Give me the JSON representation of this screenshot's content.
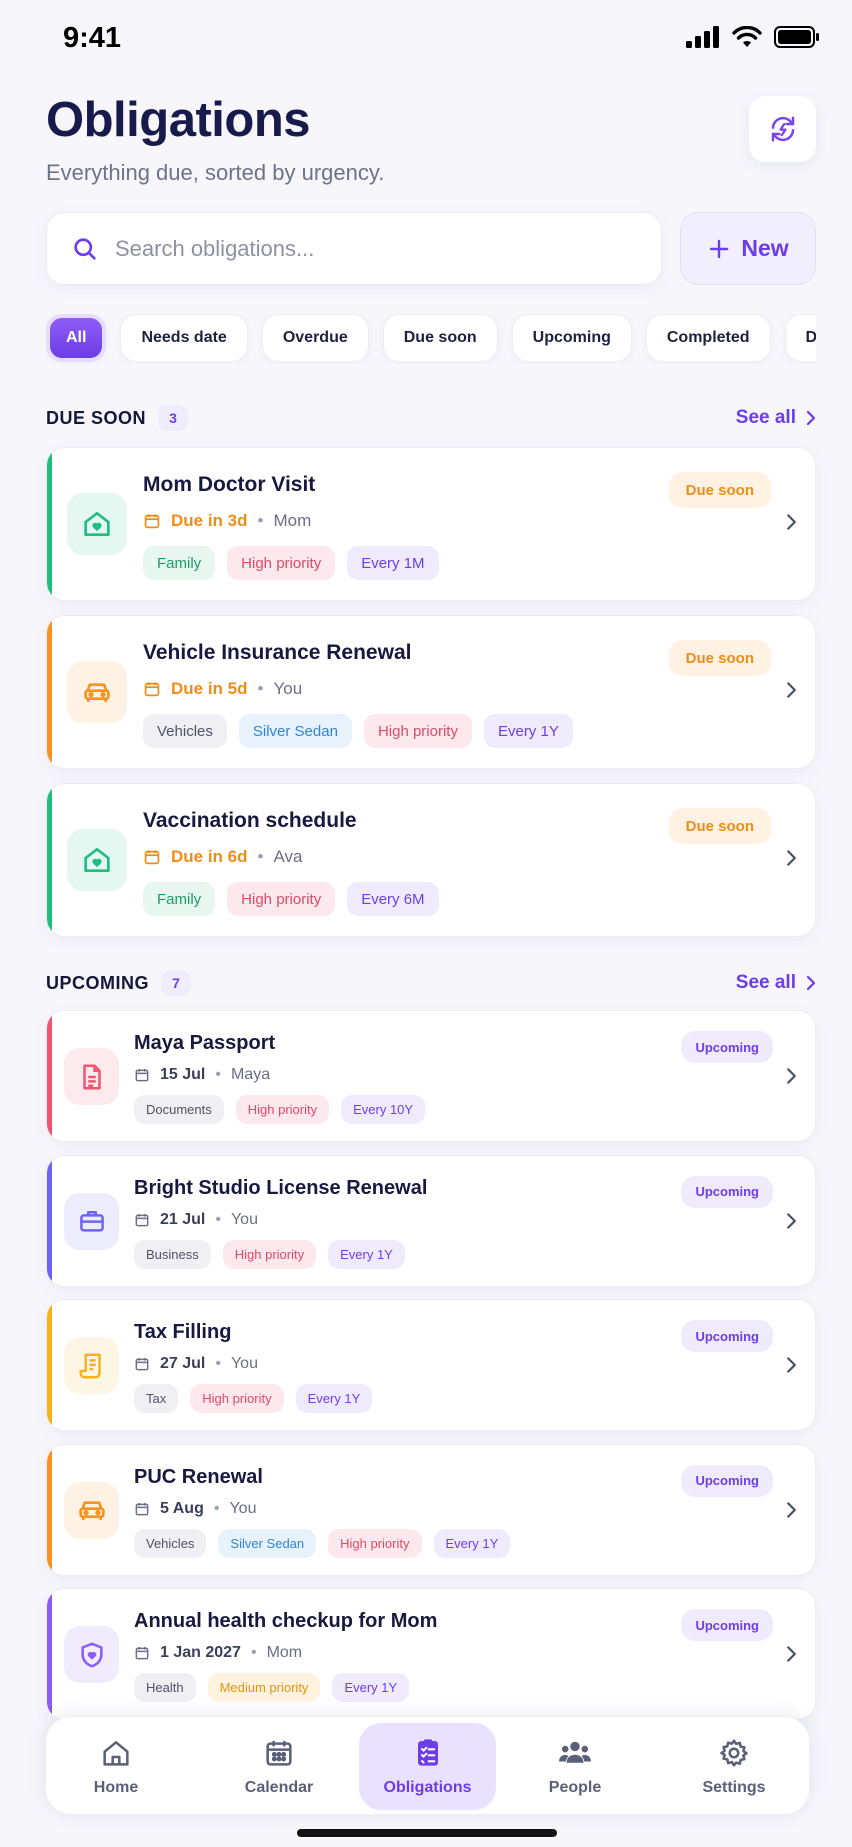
{
  "status_bar": {
    "time": "9:41"
  },
  "header": {
    "title": "Obligations",
    "subtitle": "Everything due, sorted by urgency."
  },
  "search": {
    "placeholder": "Search obligations..."
  },
  "new_button": {
    "label": "New"
  },
  "filters": [
    "All",
    "Needs date",
    "Overdue",
    "Due soon",
    "Upcoming",
    "Completed",
    "Documents"
  ],
  "sections": {
    "due_soon": {
      "title": "DUE SOON",
      "count": "3",
      "see_all": "See all",
      "items": [
        {
          "name": "Mom Doctor Visit",
          "due": "Due in 3d",
          "person": "Mom",
          "status": "Due soon",
          "accent": "#1fbf83",
          "icon": "home-heart-icon",
          "tags": [
            {
              "label": "Family",
              "kind": "t-family"
            },
            {
              "label": "High priority",
              "kind": "t-high"
            },
            {
              "label": "Every 1M",
              "kind": "t-every"
            }
          ]
        },
        {
          "name": "Vehicle Insurance Renewal",
          "due": "Due in 5d",
          "person": "You",
          "status": "Due soon",
          "accent": "#f5941f",
          "icon": "car-icon",
          "tags": [
            {
              "label": "Vehicles",
              "kind": "t-neutral"
            },
            {
              "label": "Silver Sedan",
              "kind": "t-blue"
            },
            {
              "label": "High priority",
              "kind": "t-high"
            },
            {
              "label": "Every 1Y",
              "kind": "t-every"
            }
          ]
        },
        {
          "name": "Vaccination schedule",
          "due": "Due in 6d",
          "person": "Ava",
          "status": "Due soon",
          "accent": "#1fbf83",
          "icon": "home-heart-icon",
          "tags": [
            {
              "label": "Family",
              "kind": "t-family"
            },
            {
              "label": "High priority",
              "kind": "t-high"
            },
            {
              "label": "Every 6M",
              "kind": "t-every"
            }
          ]
        }
      ]
    },
    "upcoming": {
      "title": "UPCOMING",
      "count": "7",
      "see_all": "See all",
      "items": [
        {
          "name": "Maya Passport",
          "due": "15 Jul",
          "person": "Maya",
          "status": "Upcoming",
          "accent": "#f0546f",
          "icon": "document-icon",
          "tags": [
            {
              "label": "Documents",
              "kind": "t-neutral"
            },
            {
              "label": "High priority",
              "kind": "t-high"
            },
            {
              "label": "Every 10Y",
              "kind": "t-every"
            }
          ]
        },
        {
          "name": "Bright Studio License Renewal",
          "due": "21 Jul",
          "person": "You",
          "status": "Upcoming",
          "accent": "#6f63f1",
          "icon": "briefcase-icon",
          "tags": [
            {
              "label": "Business",
              "kind": "t-neutral"
            },
            {
              "label": "High priority",
              "kind": "t-high"
            },
            {
              "label": "Every 1Y",
              "kind": "t-every"
            }
          ]
        },
        {
          "name": "Tax Filling",
          "due": "27 Jul",
          "person": "You",
          "status": "Upcoming",
          "accent": "#f6b21d",
          "icon": "receipt-icon",
          "tags": [
            {
              "label": "Tax",
              "kind": "t-neutral"
            },
            {
              "label": "High priority",
              "kind": "t-high"
            },
            {
              "label": "Every 1Y",
              "kind": "t-every"
            }
          ]
        },
        {
          "name": "PUC Renewal",
          "due": "5 Aug",
          "person": "You",
          "status": "Upcoming",
          "accent": "#f5941f",
          "icon": "car-icon",
          "tags": [
            {
              "label": "Vehicles",
              "kind": "t-neutral"
            },
            {
              "label": "Silver Sedan",
              "kind": "t-blue"
            },
            {
              "label": "High priority",
              "kind": "t-high"
            },
            {
              "label": "Every 1Y",
              "kind": "t-every"
            }
          ]
        },
        {
          "name": "Annual health checkup for Mom",
          "due": "1 Jan 2027",
          "person": "Mom",
          "status": "Upcoming",
          "accent": "#8b5cf6",
          "icon": "shield-heart-icon",
          "tags": [
            {
              "label": "Health",
              "kind": "t-neutral"
            },
            {
              "label": "Medium priority",
              "kind": "t-medium"
            },
            {
              "label": "Every 1Y",
              "kind": "t-every"
            }
          ]
        }
      ]
    }
  },
  "nav": [
    {
      "label": "Home",
      "icon": "home-icon",
      "active": false
    },
    {
      "label": "Calendar",
      "icon": "calendar-icon",
      "active": false
    },
    {
      "label": "Obligations",
      "icon": "clipboard-list-icon",
      "active": true
    },
    {
      "label": "People",
      "icon": "people-icon",
      "active": false
    },
    {
      "label": "Settings",
      "icon": "gear-icon",
      "active": false
    }
  ],
  "colors": {
    "brand": "#6d3ee8",
    "due_soon": "#ef8d18",
    "background": "#f6f6fb"
  }
}
